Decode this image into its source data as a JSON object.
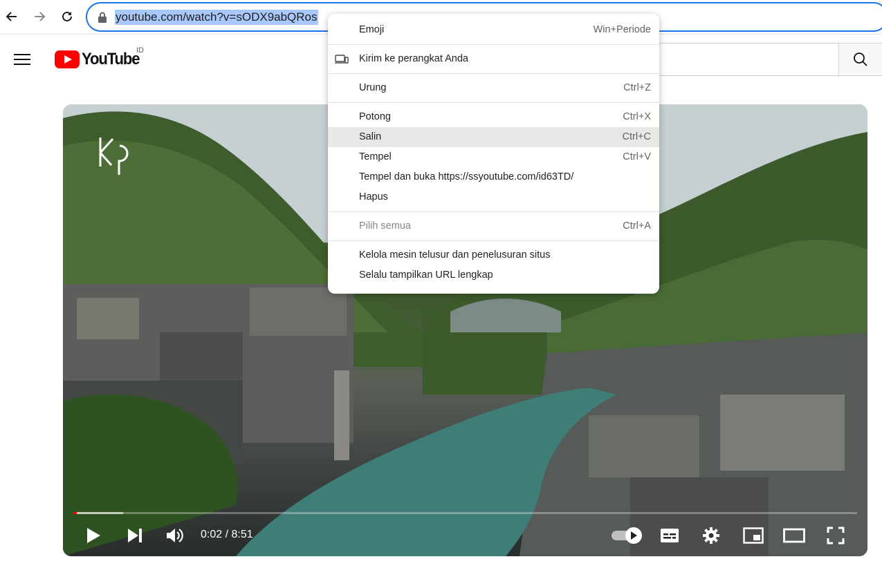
{
  "browser": {
    "back_icon": "arrow-left-icon",
    "forward_icon": "arrow-right-icon",
    "reload_icon": "reload-icon",
    "lock_icon": "lock-icon",
    "url": "youtube.com/watch?v=sODX9abQRos"
  },
  "youtube": {
    "menu_icon": "hamburger-icon",
    "wordmark": "YouTube",
    "country": "ID",
    "search_icon": "search-icon"
  },
  "video": {
    "overlay_logo": "KP",
    "time_display": "0:02 / 8:51",
    "played_fraction": 0.004,
    "controls": [
      "play-icon",
      "next-icon",
      "volume-icon",
      "autoplay-toggle-icon",
      "subtitles-icon",
      "settings-icon",
      "miniplayer-icon",
      "theater-icon",
      "fullscreen-icon"
    ]
  },
  "context_menu": {
    "emoji": {
      "label": "Emoji",
      "shortcut": "Win+Periode"
    },
    "send_to_device": {
      "label": "Kirim ke perangkat Anda",
      "icon": "devices-icon"
    },
    "undo": {
      "label": "Urung",
      "shortcut": "Ctrl+Z"
    },
    "cut": {
      "label": "Potong",
      "shortcut": "Ctrl+X"
    },
    "copy": {
      "label": "Salin",
      "shortcut": "Ctrl+C"
    },
    "paste": {
      "label": "Tempel",
      "shortcut": "Ctrl+V"
    },
    "paste_and_go": {
      "label": "Tempel dan buka https://ssyoutube.com/id63TD/"
    },
    "delete": {
      "label": "Hapus"
    },
    "select_all": {
      "label": "Pilih semua",
      "shortcut": "Ctrl+A"
    },
    "manage_search": {
      "label": "Kelola mesin telusur dan penelusuran situs"
    },
    "show_full_url": {
      "label": "Selalu tampilkan URL lengkap"
    }
  }
}
